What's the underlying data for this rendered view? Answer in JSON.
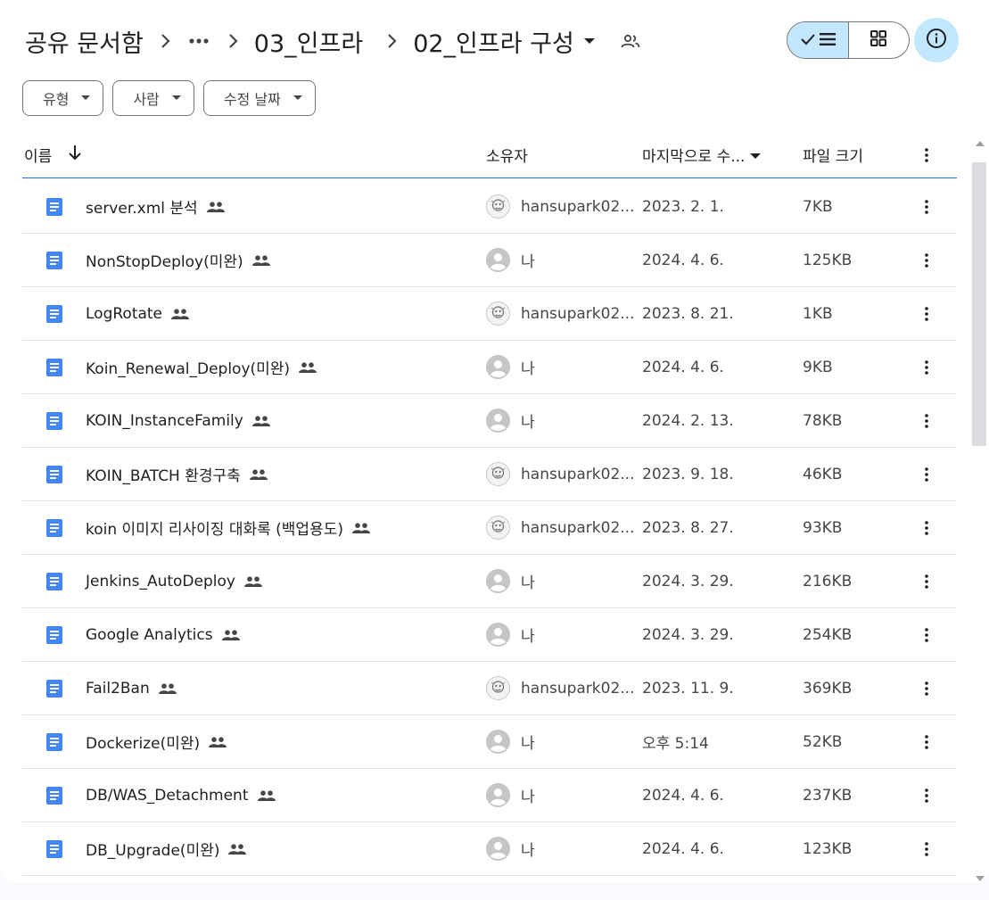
{
  "breadcrumb": {
    "root": "공유 문서함",
    "ellipsis_icon": "more-horiz-icon",
    "parent": "03_인프라",
    "current": "02_인프라 구성"
  },
  "toolbar": {
    "list_view_icon": "checked-list-icon",
    "grid_view_icon": "grid-icon",
    "info_icon": "info-icon"
  },
  "filters": [
    {
      "label": "유형"
    },
    {
      "label": "사람"
    },
    {
      "label": "수정 날짜"
    }
  ],
  "columns": {
    "name": "이름",
    "owner": "소유자",
    "modified": "마지막으로 수...",
    "size": "파일 크기"
  },
  "files": [
    {
      "name": "server.xml 분석",
      "owner": "hansupark02...",
      "owner_type": "other",
      "modified": "2023. 2. 1.",
      "size": "7KB"
    },
    {
      "name": "NonStopDeploy(미완)",
      "owner": "나",
      "owner_type": "me",
      "modified": "2024. 4. 6.",
      "size": "125KB"
    },
    {
      "name": "LogRotate",
      "owner": "hansupark02...",
      "owner_type": "other",
      "modified": "2023. 8. 21.",
      "size": "1KB"
    },
    {
      "name": "Koin_Renewal_Deploy(미완)",
      "owner": "나",
      "owner_type": "me",
      "modified": "2024. 4. 6.",
      "size": "9KB"
    },
    {
      "name": "KOIN_InstanceFamily",
      "owner": "나",
      "owner_type": "me",
      "modified": "2024. 2. 13.",
      "size": "78KB"
    },
    {
      "name": "KOIN_BATCH 환경구축",
      "owner": "hansupark02...",
      "owner_type": "other",
      "modified": "2023. 9. 18.",
      "size": "46KB"
    },
    {
      "name": "koin 이미지 리사이징 대화록 (백업용도)",
      "owner": "hansupark02...",
      "owner_type": "other",
      "modified": "2023. 8. 27.",
      "size": "93KB"
    },
    {
      "name": "Jenkins_AutoDeploy",
      "owner": "나",
      "owner_type": "me",
      "modified": "2024. 3. 29.",
      "size": "216KB"
    },
    {
      "name": "Google Analytics",
      "owner": "나",
      "owner_type": "me",
      "modified": "2024. 3. 29.",
      "size": "254KB"
    },
    {
      "name": "Fail2Ban",
      "owner": "hansupark02...",
      "owner_type": "other",
      "modified": "2023. 11. 9.",
      "size": "369KB"
    },
    {
      "name": "Dockerize(미완)",
      "owner": "나",
      "owner_type": "me",
      "modified": "오후 5:14",
      "size": "52KB"
    },
    {
      "name": "DB/WAS_Detachment",
      "owner": "나",
      "owner_type": "me",
      "modified": "2024. 4. 6.",
      "size": "237KB"
    },
    {
      "name": "DB_Upgrade(미완)",
      "owner": "나",
      "owner_type": "me",
      "modified": "2024. 4. 6.",
      "size": "123KB"
    }
  ],
  "colors": {
    "accent": "#1a73e8",
    "doc_blue": "#4285f4",
    "selected_bg": "#c2e7ff"
  }
}
